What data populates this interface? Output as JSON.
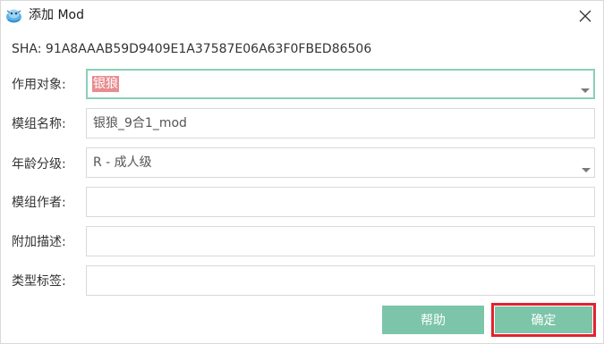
{
  "window": {
    "title": "添加 Mod",
    "icon": "app-logo-icon",
    "close_icon": "close-icon"
  },
  "sha_line": "SHA: 91A8AAAB59D9409E1A37587E06A63F0FBED86506",
  "form": {
    "target_label": "作用对象:",
    "target_value": "银狼",
    "name_label": "模组名称:",
    "name_value": "银狼_9合1_mod",
    "rating_label": "年龄分级:",
    "rating_value": "R - 成人级",
    "author_label": "模组作者:",
    "author_value": "",
    "desc_label": "附加描述:",
    "desc_value": "",
    "tags_label": "类型标签:",
    "tags_value": ""
  },
  "buttons": {
    "help_label": "帮助",
    "ok_label": "确定"
  },
  "colors": {
    "button_bg": "#7cc5a9",
    "active_border": "#8ccfb4",
    "selection_bg": "#e88c8f",
    "highlight_frame": "#e0232e"
  }
}
